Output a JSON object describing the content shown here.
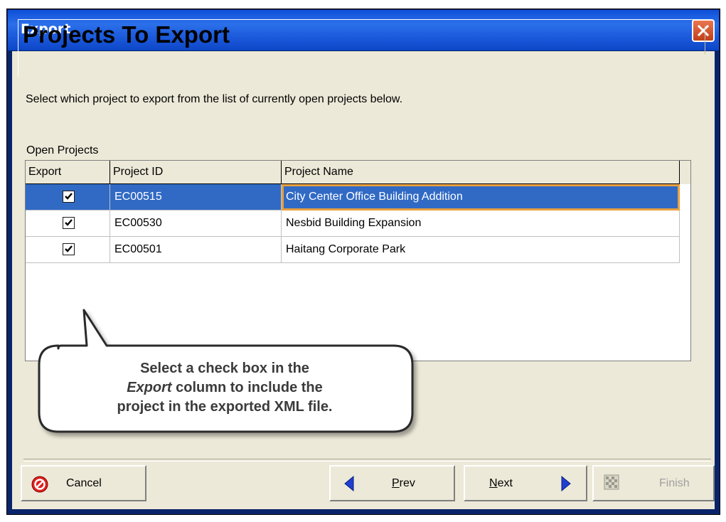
{
  "window": {
    "title": "Export"
  },
  "header": {
    "title": "Projects To Export"
  },
  "instruction": "Select which project to export from the list of currently open projects below.",
  "list_label": "Open Projects",
  "table": {
    "columns": [
      "Export",
      "Project ID",
      "Project Name"
    ],
    "rows": [
      {
        "export": true,
        "id": "EC00515",
        "name": "City Center Office Building Addition",
        "selected": true
      },
      {
        "export": true,
        "id": "EC00530",
        "name": "Nesbid Building Expansion",
        "selected": false
      },
      {
        "export": true,
        "id": "EC00501",
        "name": "Haitang Corporate Park",
        "selected": false
      }
    ]
  },
  "callout": {
    "line1": "Select a check box in the",
    "line2_emph": "Export",
    "line2_rest": " column to include the",
    "line3": "project in the exported XML file."
  },
  "buttons": {
    "cancel": "Cancel",
    "prev_mnemonic": "P",
    "prev_rest": "rev",
    "next_mnemonic": "N",
    "next_rest": "ext",
    "finish": "Finish"
  },
  "colors": {
    "selection": "#316ac5",
    "dialog_bg": "#ece9d8",
    "titlebar": "#1a58da",
    "close": "#d9532a"
  },
  "icons": [
    "close-icon",
    "cancel-icon",
    "prev-arrow-icon",
    "next-arrow-icon",
    "finish-icon",
    "checkmark-icon"
  ]
}
